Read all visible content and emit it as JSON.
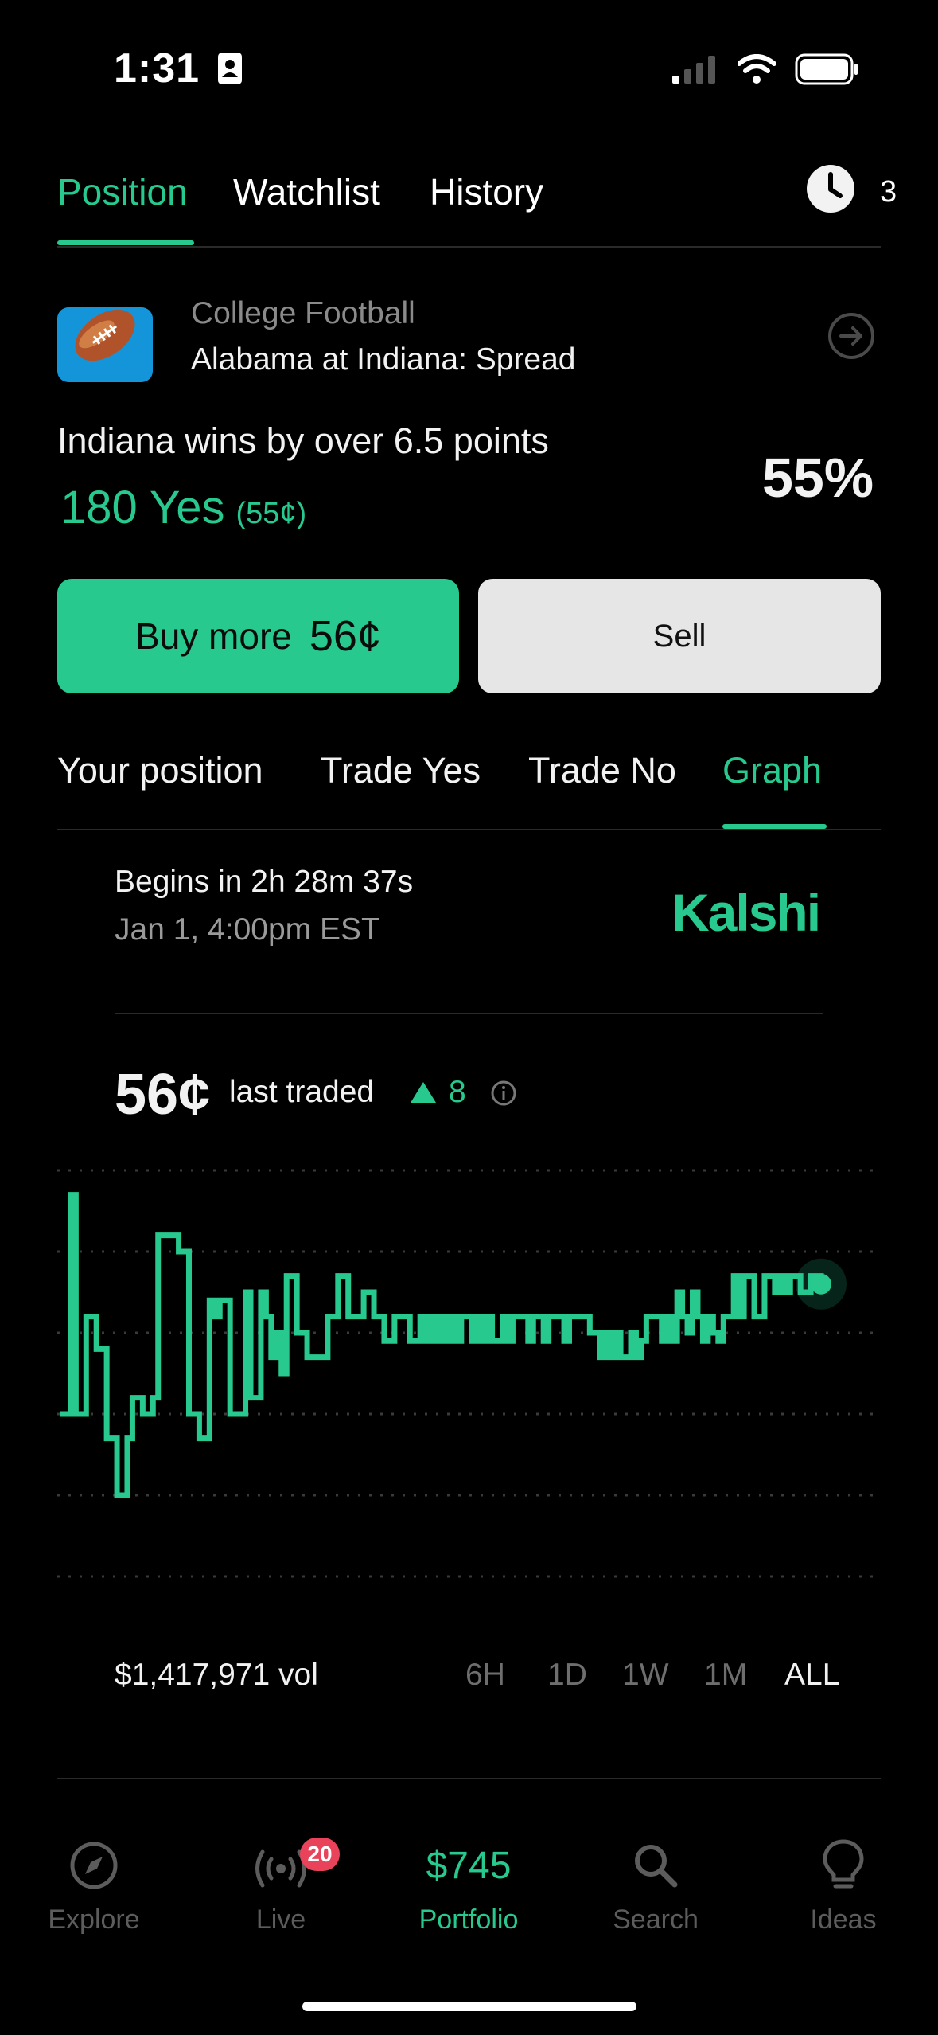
{
  "status_bar": {
    "time": "1:31"
  },
  "top_tabs": [
    {
      "label": "Position",
      "active": true
    },
    {
      "label": "Watchlist",
      "active": false
    },
    {
      "label": "History",
      "active": false
    }
  ],
  "alerts": {
    "count": "3",
    "icon": "clock-icon"
  },
  "market": {
    "category": "College Football",
    "title": "Alabama at Indiana: Spread",
    "outcome": "Indiana wins by over 6.5 points",
    "probability": "55%",
    "position_main": "180 Yes",
    "position_sub": "(55¢)"
  },
  "actions": {
    "buy_label": "Buy more",
    "buy_price": "56¢",
    "sell_label": "Sell"
  },
  "sub_tabs": [
    {
      "label": "Your position",
      "active": false
    },
    {
      "label": "Trade Yes",
      "active": false
    },
    {
      "label": "Trade No",
      "active": false
    },
    {
      "label": "Graph",
      "active": true
    }
  ],
  "event": {
    "begins": "Begins in 2h 28m 37s",
    "date": "Jan 1, 4:00pm EST",
    "brand": "Kalshi"
  },
  "price": {
    "last_price": "56¢",
    "last_label": "last traded",
    "change": "8"
  },
  "volume": "$1,417,971 vol",
  "ranges": [
    {
      "label": "6H",
      "active": false
    },
    {
      "label": "1D",
      "active": false
    },
    {
      "label": "1W",
      "active": false
    },
    {
      "label": "1M",
      "active": false
    },
    {
      "label": "ALL",
      "active": true
    }
  ],
  "bottom_nav": [
    {
      "label": "Explore",
      "icon": "compass-icon",
      "active": false
    },
    {
      "label": "Live",
      "icon": "live-icon",
      "badge": "20",
      "active": false
    },
    {
      "label": "Portfolio",
      "value": "$745",
      "active": true
    },
    {
      "label": "Search",
      "icon": "search-icon",
      "active": false
    },
    {
      "label": "Ideas",
      "icon": "lightbulb-icon",
      "active": false
    }
  ],
  "colors": {
    "accent": "#27c98f",
    "background": "#000000",
    "badge": "#e8435a",
    "sell_bg": "#e6e6e6"
  },
  "chart_data": {
    "type": "line",
    "title": "",
    "xlabel": "",
    "ylabel": "",
    "ylim": [
      20,
      70
    ],
    "grid": true,
    "y": [
      40,
      40,
      67,
      40,
      40,
      52,
      52,
      48,
      48,
      37,
      37,
      30,
      30,
      37,
      42,
      42,
      40,
      40,
      42,
      62,
      62,
      62,
      62,
      60,
      60,
      40,
      40,
      37,
      37,
      54,
      52,
      54,
      54,
      40,
      40,
      40,
      55,
      42,
      42,
      55,
      52,
      47,
      50,
      45,
      57,
      57,
      50,
      50,
      47,
      47,
      47,
      47,
      52,
      52,
      57,
      57,
      52,
      52,
      52,
      55,
      55,
      52,
      52,
      49,
      49,
      52,
      52,
      52,
      49,
      49,
      52,
      49,
      52,
      49,
      52,
      49,
      52,
      49,
      52,
      52,
      49,
      52,
      49,
      52,
      49,
      49,
      52,
      49,
      52,
      52,
      52,
      49,
      52,
      52,
      49,
      52,
      52,
      52,
      49,
      52,
      52,
      52,
      52,
      50,
      50,
      47,
      50,
      47,
      50,
      47,
      47,
      50,
      47,
      49,
      52,
      52,
      52,
      49,
      52,
      49,
      55,
      52,
      50,
      55,
      52,
      49,
      52,
      50,
      49,
      52,
      52,
      57,
      52,
      57,
      57,
      52,
      52,
      57,
      57,
      55,
      57,
      55,
      57,
      57,
      55,
      55,
      57,
      57,
      56
    ]
  }
}
